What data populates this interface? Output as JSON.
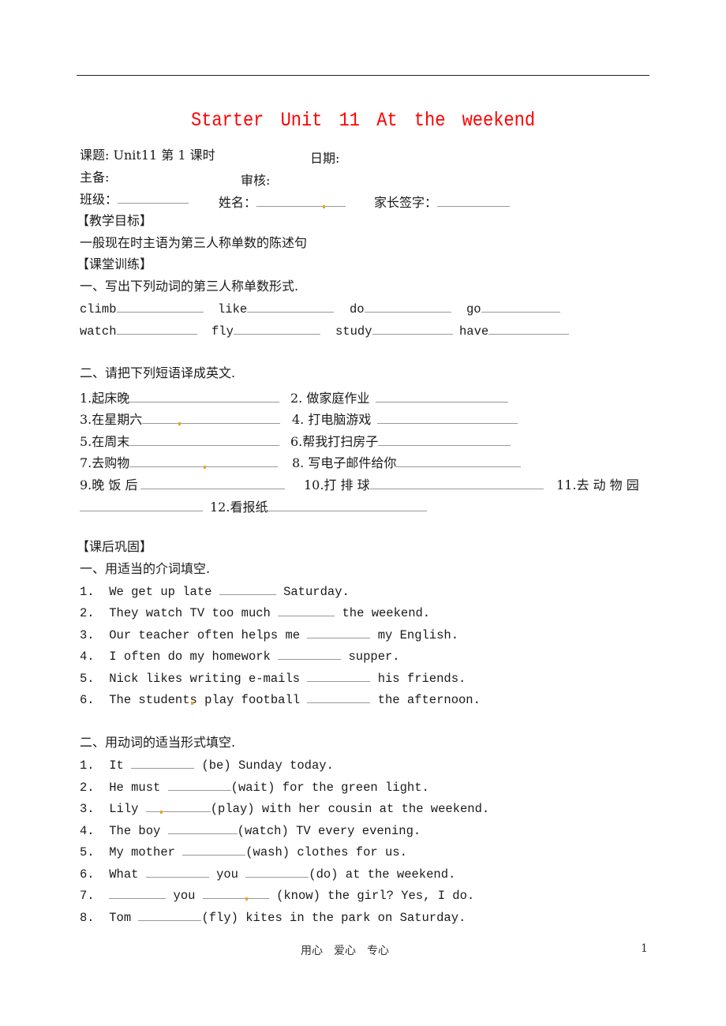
{
  "title": "Starter  Unit 11  At  the  weekend",
  "header": {
    "lesson_label": "课题: Unit11 第 1 课时",
    "date_label": "日期:",
    "preparer_label": "主备:",
    "reviewer_label": "审核:",
    "class_label": "班级：",
    "name_label": "姓名：",
    "parent_sign_label": "家长签字："
  },
  "goals": {
    "heading": "【教学目标】",
    "text": "一般现在时主语为第三人称单数的陈述句"
  },
  "classwork": {
    "heading": "【课堂训练】",
    "part1": {
      "instruction": "一、写出下列动词的第三人称单数形式.",
      "verbs": [
        "climb",
        "like",
        "do",
        "go",
        "watch",
        "fly",
        "study",
        "have"
      ]
    },
    "part2": {
      "instruction": "二、请把下列短语译成英文.",
      "items": [
        "1.起床晚",
        "2.  做家庭作业",
        "3.在星期六",
        "4.  打电脑游戏",
        "5.在周末",
        "6.帮我打扫房子",
        "7.去购物",
        "8.  写电子邮件给你",
        "9.晚 饭 后",
        "10.打 排 球",
        "11.去 动 物 园",
        "12.看报纸"
      ]
    }
  },
  "homework": {
    "heading": "【课后巩固】",
    "part1": {
      "instruction": "一、用适当的介词填空.",
      "items": [
        {
          "num": "1.",
          "before": "We get up late",
          "after": "Saturday."
        },
        {
          "num": "2.",
          "before": "They watch TV too much",
          "after": "the weekend."
        },
        {
          "num": "3.",
          "before": "Our teacher often helps me",
          "after": "my English."
        },
        {
          "num": "4.",
          "before": "I often do my homework",
          "after": "supper."
        },
        {
          "num": "5.",
          "before": "Nick likes writing e-mails",
          "after": "his friends."
        },
        {
          "num": "6.",
          "before": "The students play football",
          "after": "the afternoon."
        }
      ]
    },
    "part2": {
      "instruction": "二、用动词的适当形式填空.",
      "items": [
        {
          "num": "1.",
          "a": "It",
          "b": "(be) Sunday today."
        },
        {
          "num": "2.",
          "a": "He must",
          "b": "(wait) for the green light."
        },
        {
          "num": "3.",
          "a": "Lily",
          "b": "(play) with her cousin at the weekend."
        },
        {
          "num": "4.",
          "a": "The boy",
          "b": "(watch) TV every evening."
        },
        {
          "num": "5.",
          "a": "My mother",
          "b": "(wash) clothes for us."
        },
        {
          "num": "6.",
          "a": "What",
          "mid": "you",
          "b": "(do) at the weekend."
        },
        {
          "num": "7.",
          "a": "",
          "mid": "you",
          "b": "(know) the girl? Yes, I do."
        },
        {
          "num": "8.",
          "a": "Tom",
          "b": "(fly) kites in the park on Saturday."
        }
      ]
    }
  },
  "footer": {
    "motto": "用心　爱心　专心",
    "page_number": "1"
  },
  "colors": {
    "title": "#ff0000",
    "mark": "#e8a820"
  }
}
